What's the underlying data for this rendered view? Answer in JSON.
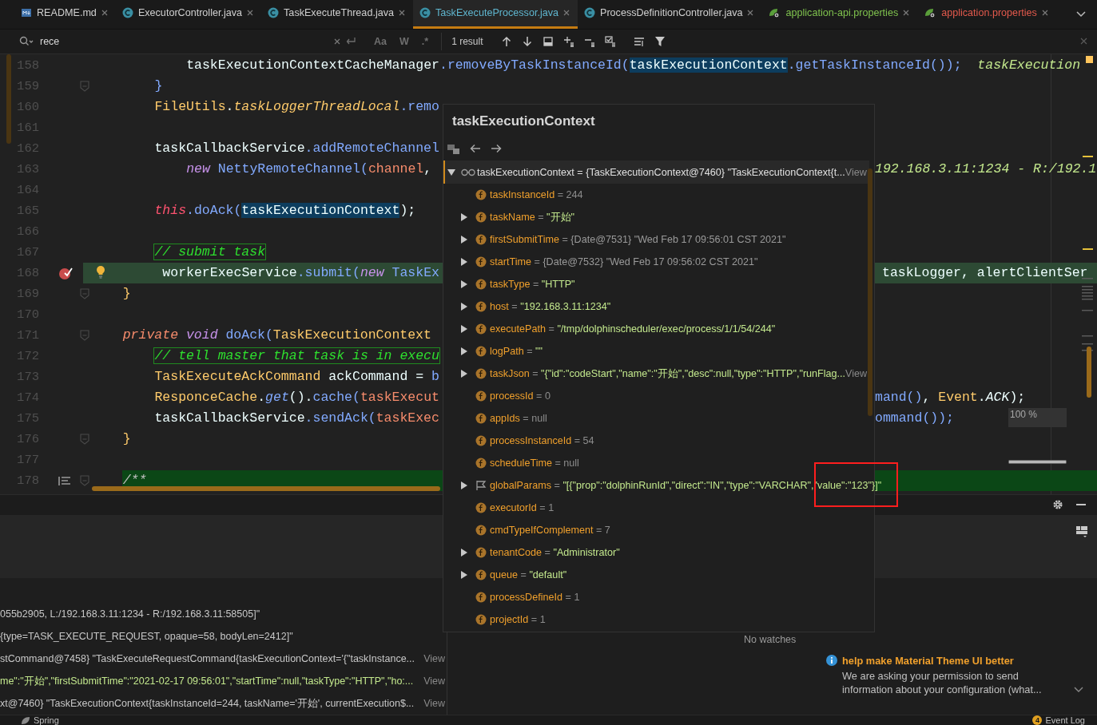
{
  "tabs": [
    {
      "label": "README.md",
      "kind": "markdown",
      "selected": false,
      "color": "#d0d0d0"
    },
    {
      "label": "ExecutorController.java",
      "kind": "java",
      "selected": false,
      "color": "#d0d0d0"
    },
    {
      "label": "TaskExecuteThread.java",
      "kind": "java",
      "selected": false,
      "color": "#d0d0d0"
    },
    {
      "label": "TaskExecuteProcessor.java",
      "kind": "java",
      "selected": true,
      "color": "#5fb6cf"
    },
    {
      "label": "ProcessDefinitionController.java",
      "kind": "java",
      "selected": false,
      "color": "#d0d0d0"
    },
    {
      "label": "application-api.properties",
      "kind": "properties",
      "selected": false,
      "color": "#7fc24e"
    },
    {
      "label": "application.properties",
      "kind": "properties",
      "selected": false,
      "color": "#e2594c"
    }
  ],
  "search": {
    "value": "rece",
    "options": [
      {
        "label": "Aa",
        "selected": false
      },
      {
        "label": "W",
        "selected": false
      },
      {
        "label": ".*",
        "selected": false
      }
    ],
    "result": "1 result"
  },
  "editor": {
    "zoom": "100 %",
    "lines": [
      {
        "number": "158",
        "fold": false,
        "kind": "normal",
        "left": [
          {
            "text": "            taskExecutionContextCacheManager",
            "kind": "plain"
          },
          {
            "text": ".removeByTaskInstanceId(",
            "kind": "method"
          },
          {
            "text": "taskExecutionContext",
            "kind": "selected"
          },
          {
            "text": ".getTaskInstanceId());",
            "kind": "method"
          },
          {
            "text": "  taskExecution",
            "kind": "hint"
          }
        ]
      },
      {
        "number": "159",
        "fold": true,
        "kind": "normal",
        "left": [
          {
            "text": "        }",
            "kind": "method"
          }
        ]
      },
      {
        "number": "160",
        "fold": false,
        "kind": "normal",
        "left": [
          {
            "text": "        FileUtils",
            "kind": "type"
          },
          {
            "text": ".",
            "kind": "plain"
          },
          {
            "text": "taskLoggerThreadLocal",
            "kind": "static"
          },
          {
            "text": ".remo",
            "kind": "method"
          }
        ]
      },
      {
        "number": "161",
        "fold": false,
        "kind": "normal"
      },
      {
        "number": "162",
        "fold": false,
        "kind": "normal",
        "left": [
          {
            "text": "        taskCallbackService",
            "kind": "plain"
          },
          {
            "text": ".addRemoteChannel",
            "kind": "method"
          }
        ]
      },
      {
        "number": "163",
        "fold": false,
        "kind": "normal",
        "left": [
          {
            "text": "            new",
            "kind": "keyword"
          },
          {
            "text": " NettyRemoteChannel(",
            "kind": "method"
          },
          {
            "text": "channel",
            "kind": "param"
          },
          {
            "text": ",",
            "kind": "plain"
          }
        ],
        "right": [
          {
            "text": "192.168.3.11:1234 - R:/192.1",
            "kind": "hint"
          }
        ]
      },
      {
        "number": "164",
        "fold": false,
        "kind": "normal"
      },
      {
        "number": "165",
        "fold": false,
        "kind": "normal",
        "left": [
          {
            "text": "        this",
            "kind": "this"
          },
          {
            "text": ".doAck(",
            "kind": "method"
          },
          {
            "text": "taskExecutionContext",
            "kind": "selected"
          },
          {
            "text": ");",
            "kind": "plain"
          }
        ]
      },
      {
        "number": "166",
        "fold": false,
        "kind": "normal"
      },
      {
        "number": "167",
        "fold": false,
        "kind": "normal",
        "left": [
          {
            "text": "        // submit task",
            "kind": "comment"
          }
        ]
      },
      {
        "number": "168",
        "fold": false,
        "kind": "execution",
        "left": [
          {
            "text": "         workerExecService",
            "kind": "plain"
          },
          {
            "text": ".submit(",
            "kind": "method"
          },
          {
            "text": "new",
            "kind": "keyword"
          },
          {
            "text": " TaskEx",
            "kind": "method"
          }
        ],
        "right": [
          {
            "text": "taskLogger, alertClientSer",
            "kind": "plain"
          }
        ]
      },
      {
        "number": "169",
        "fold": true,
        "kind": "normal",
        "left": [
          {
            "text": "    }",
            "kind": "type"
          }
        ]
      },
      {
        "number": "170",
        "fold": false,
        "kind": "normal"
      },
      {
        "number": "171",
        "fold": true,
        "kind": "normal",
        "left": [
          {
            "text": "    private",
            "kind": "modifier"
          },
          {
            "text": " void",
            "kind": "keyword"
          },
          {
            "text": " doAck(",
            "kind": "method"
          },
          {
            "text": "TaskExecutionContext",
            "kind": "type"
          }
        ]
      },
      {
        "number": "172",
        "fold": false,
        "kind": "normal",
        "left": [
          {
            "text": "        // tell master that task is in execu",
            "kind": "comment"
          }
        ]
      },
      {
        "number": "173",
        "fold": false,
        "kind": "normal",
        "left": [
          {
            "text": "        TaskExecuteAckCommand",
            "kind": "type"
          },
          {
            "text": " ackCommand = ",
            "kind": "plain"
          },
          {
            "text": "b",
            "kind": "method"
          }
        ]
      },
      {
        "number": "174",
        "fold": false,
        "kind": "normal",
        "left": [
          {
            "text": "        ResponceCache",
            "kind": "type"
          },
          {
            "text": ".",
            "kind": "plain"
          },
          {
            "text": "get",
            "kind": "static-method"
          },
          {
            "text": "().",
            "kind": "plain"
          },
          {
            "text": "cache(",
            "kind": "method"
          },
          {
            "text": "taskExecut",
            "kind": "param"
          }
        ],
        "right": [
          {
            "text": "mand()",
            "kind": "method"
          },
          {
            "text": ", ",
            "kind": "plain"
          },
          {
            "text": "Event",
            "kind": "type"
          },
          {
            "text": ".",
            "kind": "plain"
          },
          {
            "text": "ACK",
            "kind": "constant"
          },
          {
            "text": ");",
            "kind": "plain"
          }
        ]
      },
      {
        "number": "175",
        "fold": false,
        "kind": "normal",
        "left": [
          {
            "text": "        taskCallbackService",
            "kind": "plain"
          },
          {
            "text": ".sendAck(",
            "kind": "method"
          },
          {
            "text": "taskExec",
            "kind": "param"
          }
        ],
        "right": [
          {
            "text": "ommand());",
            "kind": "method"
          }
        ]
      },
      {
        "number": "176",
        "fold": true,
        "kind": "normal",
        "left": [
          {
            "text": "    }",
            "kind": "type"
          }
        ]
      },
      {
        "number": "177",
        "fold": false,
        "kind": "normal"
      },
      {
        "number": "178",
        "fold": true,
        "kind": "doc",
        "left": [
          {
            "text": "    /**",
            "kind": "doc"
          }
        ]
      }
    ]
  },
  "popup": {
    "title": "taskExecutionContext",
    "root": {
      "name": "taskExecutionContext",
      "operator": "=",
      "value": "{TaskExecutionContext@7460} \"TaskExecutionContext{t...",
      "view": "View",
      "expanded": true
    },
    "fields": [
      {
        "name": "taskInstanceId",
        "operator": "=",
        "value": "244",
        "kind": "number",
        "expandable": false
      },
      {
        "name": "taskName",
        "operator": "=",
        "value": "\"开始\"",
        "kind": "string",
        "expandable": true
      },
      {
        "name": "firstSubmitTime",
        "operator": "=",
        "value": "{Date@7531} \"Wed Feb 17 09:56:01 CST 2021\"",
        "kind": "object",
        "expandable": true
      },
      {
        "name": "startTime",
        "operator": "=",
        "value": "{Date@7532} \"Wed Feb 17 09:56:02 CST 2021\"",
        "kind": "object",
        "expandable": true
      },
      {
        "name": "taskType",
        "operator": "=",
        "value": "\"HTTP\"",
        "kind": "string",
        "expandable": true
      },
      {
        "name": "host",
        "operator": "=",
        "value": "\"192.168.3.11:1234\"",
        "kind": "string",
        "expandable": true
      },
      {
        "name": "executePath",
        "operator": "=",
        "value": "\"/tmp/dolphinscheduler/exec/process/1/1/54/244\"",
        "kind": "string",
        "expandable": true
      },
      {
        "name": "logPath",
        "operator": "=",
        "value": "\"\"",
        "kind": "string",
        "expandable": true
      },
      {
        "name": "taskJson",
        "operator": "=",
        "value": "\"{\"id\":\"codeStart\",\"name\":\"开始\",\"desc\":null,\"type\":\"HTTP\",\"runFlag...",
        "view": "View",
        "kind": "string",
        "expandable": true
      },
      {
        "name": "processId",
        "operator": "=",
        "value": "0",
        "kind": "number",
        "expandable": false
      },
      {
        "name": "appIds",
        "operator": "=",
        "value": "null",
        "kind": "number",
        "expandable": false
      },
      {
        "name": "processInstanceId",
        "operator": "=",
        "value": "54",
        "kind": "number",
        "expandable": false
      },
      {
        "name": "scheduleTime",
        "operator": "=",
        "value": "null",
        "kind": "number",
        "expandable": false
      },
      {
        "name": "globalParams",
        "operator": "=",
        "value": "\"[{\"prop\":\"dolphinRunId\",\"direct\":\"IN\",\"type\":\"VARCHAR\",\"value\":\"123\"}]\"",
        "kind": "parameter",
        "expandable": true
      },
      {
        "name": "executorId",
        "operator": "=",
        "value": "1",
        "kind": "number",
        "expandable": false
      },
      {
        "name": "cmdTypeIfComplement",
        "operator": "=",
        "value": "7",
        "kind": "number",
        "expandable": false
      },
      {
        "name": "tenantCode",
        "operator": "=",
        "value": "\"Administrator\"",
        "kind": "string",
        "expandable": true
      },
      {
        "name": "queue",
        "operator": "=",
        "value": "\"default\"",
        "kind": "string",
        "expandable": true
      },
      {
        "name": "processDefineId",
        "operator": "=",
        "value": "1",
        "kind": "number",
        "expandable": false
      },
      {
        "name": "projectId",
        "operator": "=",
        "value": "1",
        "kind": "number",
        "expandable": false
      }
    ]
  },
  "debug": {
    "variables": [
      {
        "text": "055b2905, L:/192.168.3.11:1234 - R:/192.168.3.11:58505]\"",
        "kind": "object"
      },
      {
        "text": "{type=TASK_EXECUTE_REQUEST, opaque=58, bodyLen=2412]\"",
        "kind": "object"
      },
      {
        "text": "stCommand@7458} \"TaskExecuteRequestCommand{taskExecutionContext='{\"taskInstance...",
        "kind": "object",
        "view": "View"
      },
      {
        "text": "me\":\"开始\",\"firstSubmitTime\":\"2021-02-17 09:56:01\",\"startTime\":null,\"taskType\":\"HTTP\",\"ho:...",
        "kind": "string",
        "view": "View"
      },
      {
        "text": "xt@7460} \"TaskExecutionContext{taskInstanceId=244, taskName='开始', currentExecution$...",
        "kind": "object",
        "view": "View"
      }
    ],
    "watches_empty": "No watches",
    "notification": {
      "title": "help make Material Theme UI better",
      "body": "We are asking your permission to send information about your configuration (what..."
    }
  },
  "status_bar": {
    "left": "Spring",
    "event_log": "Event Log",
    "event_count": "4"
  }
}
